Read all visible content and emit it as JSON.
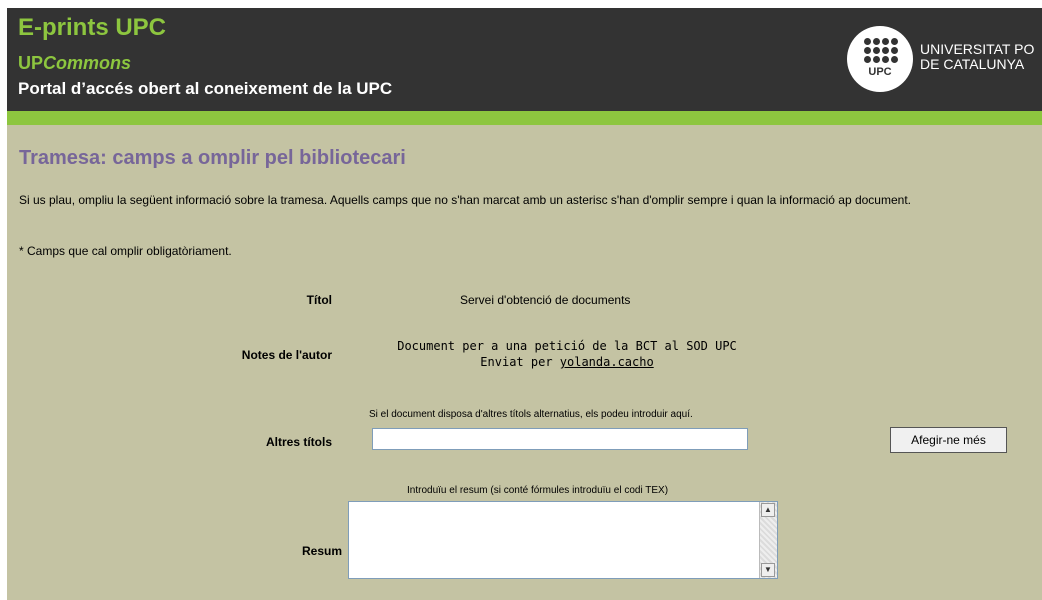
{
  "header": {
    "brand": "E-prints UPC",
    "sub_prefix": "UP",
    "sub_italic": "Commons",
    "tagline": "Portal d’accés obert al coneixement de la UPC",
    "logo_text": "UPC",
    "university_line1": "UNIVERSITAT PO",
    "university_line2": "DE CATALUNYA"
  },
  "page": {
    "title": "Tramesa: camps a omplir pel bibliotecari",
    "intro": "Si us plau, ompliu la següent informació sobre la tramesa. Aquells camps que no s'han marcat amb un asterisc s'han d'omplir sempre i quan la informació ap document.",
    "required_note": "* Camps que cal omplir obligatòriament."
  },
  "fields": {
    "title_label": "Títol",
    "title_value": "Servei d'obtenció de documents",
    "notes_label": "Notes de l'autor",
    "notes_line1": "Document per a una petició de la BCT al SOD UPC",
    "notes_line2_prefix": "Enviat per ",
    "notes_user": "yolanda.cacho",
    "alt_titles_hint": "Si el document disposa d'altres títols alternatius, els podeu introduir aquí.",
    "alt_titles_label": "Altres títols",
    "alt_titles_value": "",
    "add_more_button": "Afegir-ne més",
    "abstract_hint": "Introduïu el resum (si conté fórmules introduïu el codi TEX)",
    "abstract_label": "Resum",
    "abstract_value": ""
  },
  "colors": {
    "header_bg": "#333333",
    "brand_green": "#8dc63f",
    "page_bg": "#c4c3a3",
    "title_purple": "#776699"
  }
}
